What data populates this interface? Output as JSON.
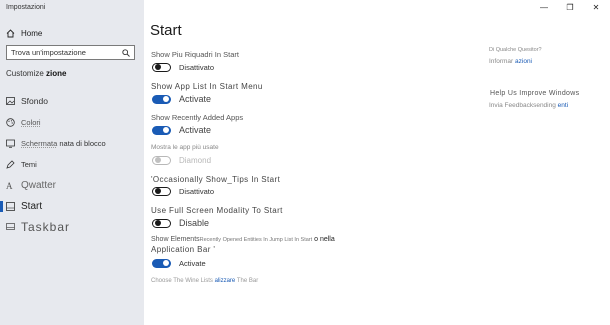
{
  "window": {
    "title": "Impostazioni",
    "minimize": "—",
    "maximize": "❐",
    "close": "✕"
  },
  "sidebar": {
    "home_label": "Home",
    "search_placeholder": "Trova un'impostazione",
    "section_prefix": "Customize",
    "section_suffix": "zione",
    "items": [
      {
        "label": "Sfondo",
        "icon": "image-icon"
      },
      {
        "label": "Colori",
        "icon": "palette-icon"
      },
      {
        "label_part1": "Schermata",
        "label_part2": "nata di blocco",
        "icon": "lock-screen-icon"
      },
      {
        "label": "Temi",
        "icon": "themes-icon"
      },
      {
        "label": "Qwatter",
        "icon": "font-icon"
      },
      {
        "label": "Start",
        "icon": "start-icon"
      },
      {
        "label": "Taskbar",
        "icon": "taskbar-icon"
      }
    ]
  },
  "main": {
    "title": "Start",
    "settings": [
      {
        "label": "Show Piu Riquadri In Start",
        "state": "Disattivato"
      },
      {
        "label": "Show App List In Start Menu",
        "state": "Activate"
      },
      {
        "label": "Show Recently Added Apps",
        "state": "Activate"
      },
      {
        "label": "Mostra le app più usate",
        "state": "Diamond"
      },
      {
        "label": "'Occasionally Show_Tips In Start",
        "state": "Disattivato"
      },
      {
        "label": "Use Full Screen Modality To Start",
        "state": "Disable"
      },
      {
        "label_part1": "Show Elements",
        "label_part2": "Recently Opened Entities In Jump List In Start",
        "label_part3": "o nella",
        "label_line2": "Application Bar '",
        "state": "Activate"
      }
    ],
    "bottom_link_prefix": "Choose The Wine Lists",
    "bottom_link": "alizzare",
    "bottom_link_suffix": "The Bar"
  },
  "right": {
    "question": "Di Qualche Quesitor?",
    "info_prefix": "Informar",
    "info_link": "azioni",
    "help_title": "Help Us Improve Windows",
    "feedback_prefix": "Invia Feedbacksending",
    "feedback_link": "enti"
  },
  "colors": {
    "accent": "#1a5bb5",
    "sidebar_bg": "#e7e9ee"
  }
}
